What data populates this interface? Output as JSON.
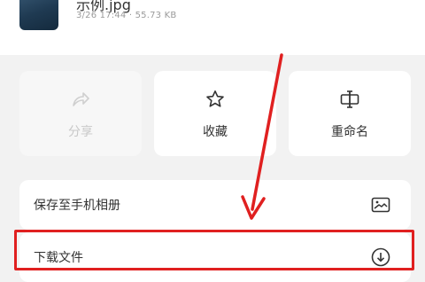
{
  "file": {
    "name": "示例.jpg",
    "meta": "3/26 17:44 · 55.73 KB"
  },
  "actions": [
    {
      "label": "分享",
      "icon": "share-icon",
      "enabled": false
    },
    {
      "label": "收藏",
      "icon": "star-icon",
      "enabled": true
    },
    {
      "label": "重命名",
      "icon": "rename-icon",
      "enabled": true
    }
  ],
  "list": [
    {
      "label": "保存至手机相册",
      "icon": "image-icon"
    },
    {
      "label": "下载文件",
      "icon": "download-icon"
    }
  ],
  "colors": {
    "background": "#f2f2f2",
    "card": "#ffffff",
    "disabled_text": "#c8c8c8",
    "annotation": "#e02020"
  },
  "annotation": {
    "highlighted_item": "下载文件"
  }
}
